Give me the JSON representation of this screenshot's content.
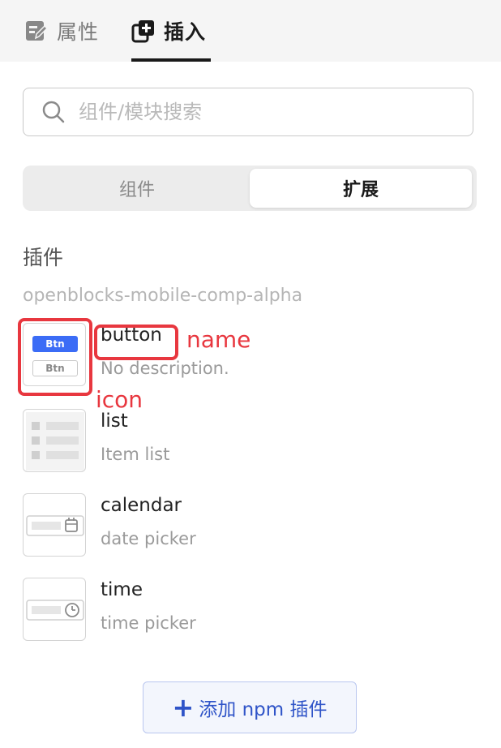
{
  "tabs": {
    "properties": "属性",
    "insert": "插入"
  },
  "search": {
    "placeholder": "组件/模块搜索",
    "value": ""
  },
  "segment": {
    "components": "组件",
    "extensions": "扩展",
    "selected": "扩展"
  },
  "section": {
    "title": "插件",
    "package": "openblocks-mobile-comp-alpha"
  },
  "items": [
    {
      "name": "button",
      "description": "No description.",
      "icon": "button-preview-icon"
    },
    {
      "name": "list",
      "description": "Item list",
      "icon": "list-preview-icon"
    },
    {
      "name": "calendar",
      "description": "date picker",
      "icon": "calendar-preview-icon"
    },
    {
      "name": "time",
      "description": "time picker",
      "icon": "time-preview-icon"
    }
  ],
  "thumb_text": {
    "btn_primary": "Btn",
    "btn_secondary": "Btn"
  },
  "annotations": {
    "name": "name",
    "icon": "icon"
  },
  "add_button": {
    "plus": "+",
    "label": "添加 npm 插件"
  },
  "colors": {
    "accent": "#2f54c8",
    "annotation": "#e8373f",
    "primary_button": "#3b6cf6"
  }
}
